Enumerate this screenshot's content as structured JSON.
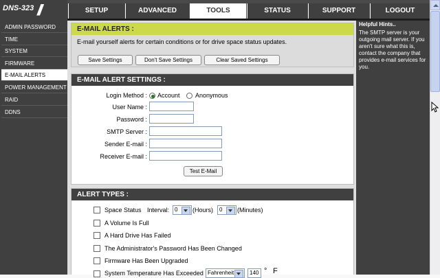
{
  "brand": {
    "name": "DNS-323"
  },
  "tabs": [
    {
      "label": "SETUP"
    },
    {
      "label": "ADVANCED"
    },
    {
      "label": "TOOLS"
    },
    {
      "label": "STATUS"
    },
    {
      "label": "SUPPORT"
    },
    {
      "label": "LOGOUT"
    }
  ],
  "sidebar": {
    "items": [
      {
        "label": "ADMIN PASSWORD"
      },
      {
        "label": "TIME"
      },
      {
        "label": "SYSTEM"
      },
      {
        "label": "FIRMWARE"
      },
      {
        "label": "E-MAIL ALERTS"
      },
      {
        "label": "POWER MANAGEMENT"
      },
      {
        "label": "RAID"
      },
      {
        "label": "DDNS"
      }
    ]
  },
  "email_alerts": {
    "title": "E-MAIL ALERTS :",
    "description": "E-mail yourself alerts for certain conditions or for drive space status updates.",
    "save_label": "Save Settings",
    "dont_save_label": "Don't Save Settings",
    "clear_label": "Clear Saved Settings"
  },
  "settings": {
    "title": "E-MAIL ALERT SETTINGS :",
    "login_method_label": "Login Method :",
    "login_options": [
      "Account",
      "Anonymous"
    ],
    "login_selected": "Account",
    "username_label": "User Name :",
    "username_value": "",
    "password_label": "Password :",
    "password_value": "",
    "smtp_label": "SMTP Server :",
    "smtp_value": "",
    "sender_label": "Sender E-mail :",
    "sender_value": "",
    "receiver_label": "Receiver E-mail :",
    "receiver_value": "",
    "test_label": "Test E-Mail"
  },
  "alert_types": {
    "title": "ALERT TYPES :",
    "space_status_label": "Space Status",
    "interval_label": "Interval:",
    "hours_value": "0",
    "hours_label": "(Hours)",
    "minutes_value": "0",
    "minutes_label": "(Minutes)",
    "volume_full_label": "A Volume Is Full",
    "drive_failed_label": "A Hard Drive Has Failed",
    "admin_pw_label": "The Administrator's Password Has Been Changed",
    "firmware_label": "Firmware Has Been Upgraded",
    "temp_label": "System Temperature Has Exceeded",
    "temp_unit_select": "Fahrenheit",
    "temp_value": "140",
    "temp_deg": "°",
    "temp_unit": "F"
  },
  "hints": {
    "title": "Helpful Hints..",
    "text": "The SMTP server is your outgoing mail server. If you aren't sure what this is, contact the company that provides e-mail services for you."
  },
  "colors": {
    "dark": "#404040",
    "accent": "#ccd94a",
    "panel_bg": "#dfdfdf"
  },
  "icons": {
    "radio": "radio-icon",
    "checkbox": "checkbox-icon",
    "dropdown": "chevron-down-icon",
    "cursor": "mouse-cursor-icon"
  }
}
